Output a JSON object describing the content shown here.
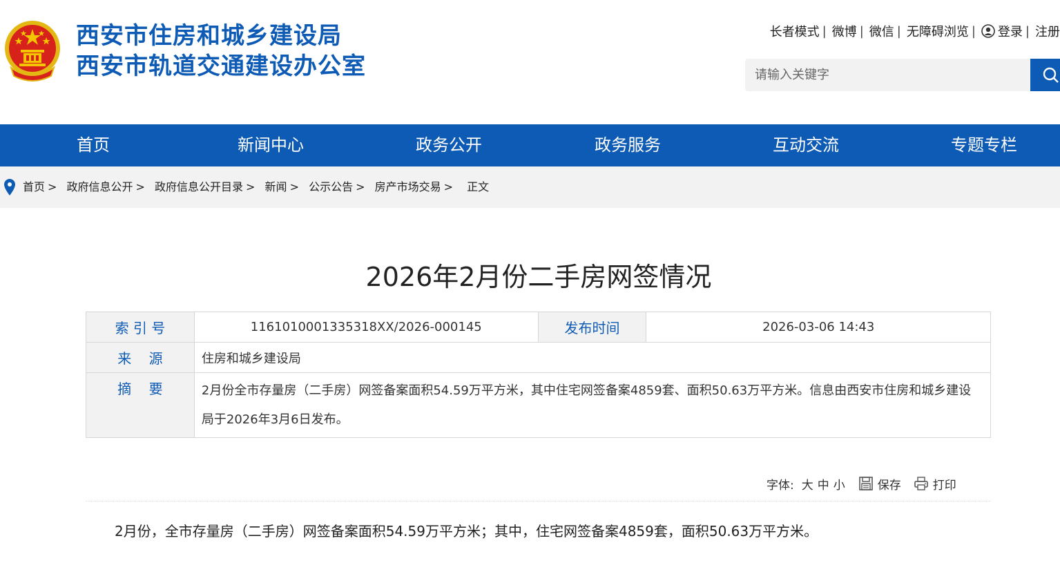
{
  "header": {
    "site_name_1": "西安市住房和城乡建设局",
    "site_name_2": "西安市轨道交通建设办公室",
    "top_links": [
      "长者模式",
      "微博",
      "微信",
      "无障碍浏览",
      "登录",
      "注册"
    ],
    "search_placeholder": "请输入关键字"
  },
  "nav": {
    "items": [
      "首页",
      "新闻中心",
      "政务公开",
      "政务服务",
      "互动交流",
      "专题专栏"
    ]
  },
  "breadcrumb": {
    "items": [
      "首页",
      "政府信息公开",
      "政府信息公开目录",
      "新闻",
      "公示公告",
      "房产市场交易"
    ],
    "separator": ">",
    "current": "正文"
  },
  "article": {
    "title": "2026年2月份二手房网签情况",
    "info": {
      "index_label": "索 引 号",
      "index_value": "1161010001335318XX/2026-000145",
      "publish_label": "发布时间",
      "publish_value": "2026-03-06 14:43",
      "source_label": "来    源",
      "source_value": "住房和城乡建设局",
      "summary_label": "摘    要",
      "summary_value": "2月份全市存量房（二手房）网签备案面积54.59万平方米，其中住宅网签备案4859套、面积50.63万平方米。信息由西安市住房和城乡建设局于2026年3月6日发布。"
    },
    "tools": {
      "font_label": "字体:",
      "size_large": "大",
      "size_medium": "中",
      "size_small": "小",
      "save": "保存",
      "print": "打印"
    },
    "body": "2月份，全市存量房（二手房）网签备案面积54.59万平方米；其中，住宅网签备案4859套，面积50.63万平方米。"
  },
  "colors": {
    "brand_blue": "#0e5bb5",
    "emblem_red": "#d7221b",
    "emblem_gold": "#f5c400",
    "breadcrumb_bg": "#f2f2f2"
  }
}
